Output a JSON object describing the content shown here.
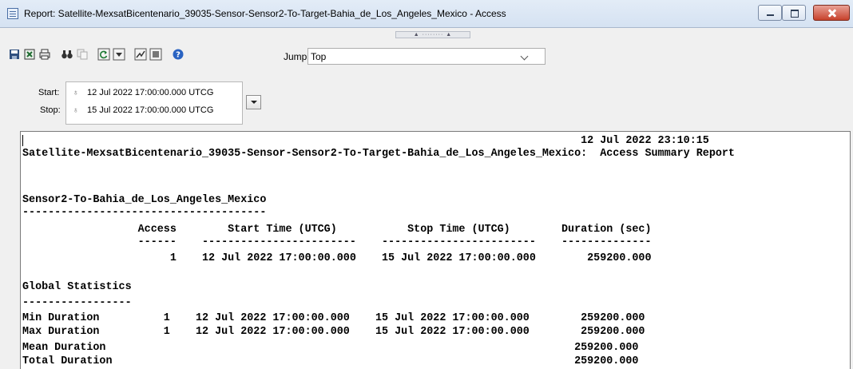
{
  "window": {
    "title": "Report:  Satellite-MexsatBicentenario_39035-Sensor-Sensor2-To-Target-Bahia_de_Los_Angeles_Mexico - Access",
    "splitter": "▲ ········ ▲"
  },
  "toolbar": {
    "icons": [
      "save-icon",
      "export-excel-icon",
      "print-icon",
      "find-icon",
      "copy-icon",
      "refresh-icon",
      "report-options-icon",
      "graph-icon",
      "filter-icon",
      "help-icon"
    ],
    "jump_label": "Jump",
    "jump_value": "Top"
  },
  "time": {
    "start_label": "Start:",
    "start_value": "12 Jul 2022 17:00:00.000 UTCG",
    "stop_label": "Stop:",
    "stop_value": "15 Jul 2022 17:00:00.000 UTCG"
  },
  "report": {
    "lines": [
      "                                                                                       12 Jul 2022 23:10:15",
      "Satellite-MexsatBicentenario_39035-Sensor-Sensor2-To-Target-Bahia_de_Los_Angeles_Mexico:  Access Summary Report",
      "",
      "",
      "Sensor2-To-Bahia_de_Los_Angeles_Mexico",
      "--------------------------------------",
      "                  Access        Start Time (UTCG)           Stop Time (UTCG)        Duration (sec)",
      "                  ------    ------------------------    ------------------------    --------------",
      "                       1    12 Jul 2022 17:00:00.000    15 Jul 2022 17:00:00.000        259200.000",
      "",
      "Global Statistics",
      "-----------------",
      "Min Duration          1    12 Jul 2022 17:00:00.000    15 Jul 2022 17:00:00.000        259200.000",
      "Max Duration          1    12 Jul 2022 17:00:00.000    15 Jul 2022 17:00:00.000        259200.000",
      "Mean Duration                                                                         259200.000",
      "Total Duration                                                                        259200.000"
    ]
  }
}
